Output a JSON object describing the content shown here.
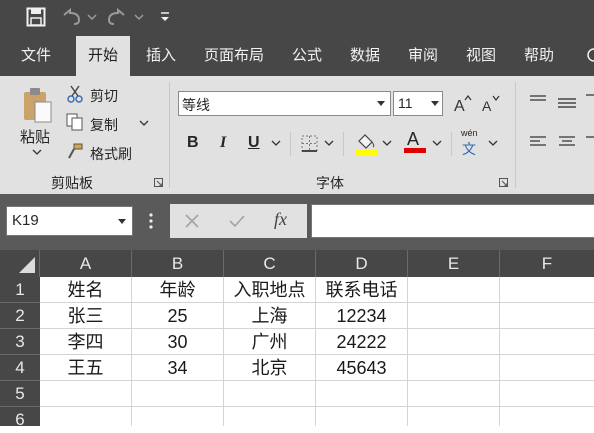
{
  "qat": {
    "save_icon": "save-icon",
    "undo_icon": "undo-icon",
    "redo_icon": "redo-icon",
    "customize_icon": "customize-qat-icon"
  },
  "tabs": [
    "文件",
    "开始",
    "插入",
    "页面布局",
    "公式",
    "数据",
    "审阅",
    "视图",
    "帮助"
  ],
  "active_tab": "开始",
  "ribbon": {
    "clipboard": {
      "paste": "粘贴",
      "cut": "剪切",
      "copy": "复制",
      "format_painter": "格式刷",
      "group_label": "剪贴板"
    },
    "font": {
      "font_name": "等线",
      "font_size": "11",
      "bold": "B",
      "italic": "I",
      "underline": "U",
      "font_color_letter": "A",
      "fill_color": "#ffff00",
      "font_color": "#e00000",
      "phonetic": "wén",
      "phonetic_char": "文",
      "group_label": "字体"
    }
  },
  "formula_bar": {
    "name_box": "K19",
    "fx": "fx",
    "content": ""
  },
  "sheet": {
    "columns": [
      "A",
      "B",
      "C",
      "D",
      "E",
      "F"
    ],
    "rows": [
      "1",
      "2",
      "3",
      "4",
      "5",
      "6"
    ],
    "cells": [
      [
        "姓名",
        "年龄",
        "入职地点",
        "联系电话",
        "",
        ""
      ],
      [
        "张三",
        "25",
        "上海",
        "12234",
        "",
        ""
      ],
      [
        "李四",
        "30",
        "广州",
        "24222",
        "",
        ""
      ],
      [
        "王五",
        "34",
        "北京",
        "45643",
        "",
        ""
      ],
      [
        "",
        "",
        "",
        "",
        "",
        ""
      ],
      [
        "",
        "",
        "",
        "",
        "",
        ""
      ]
    ]
  }
}
